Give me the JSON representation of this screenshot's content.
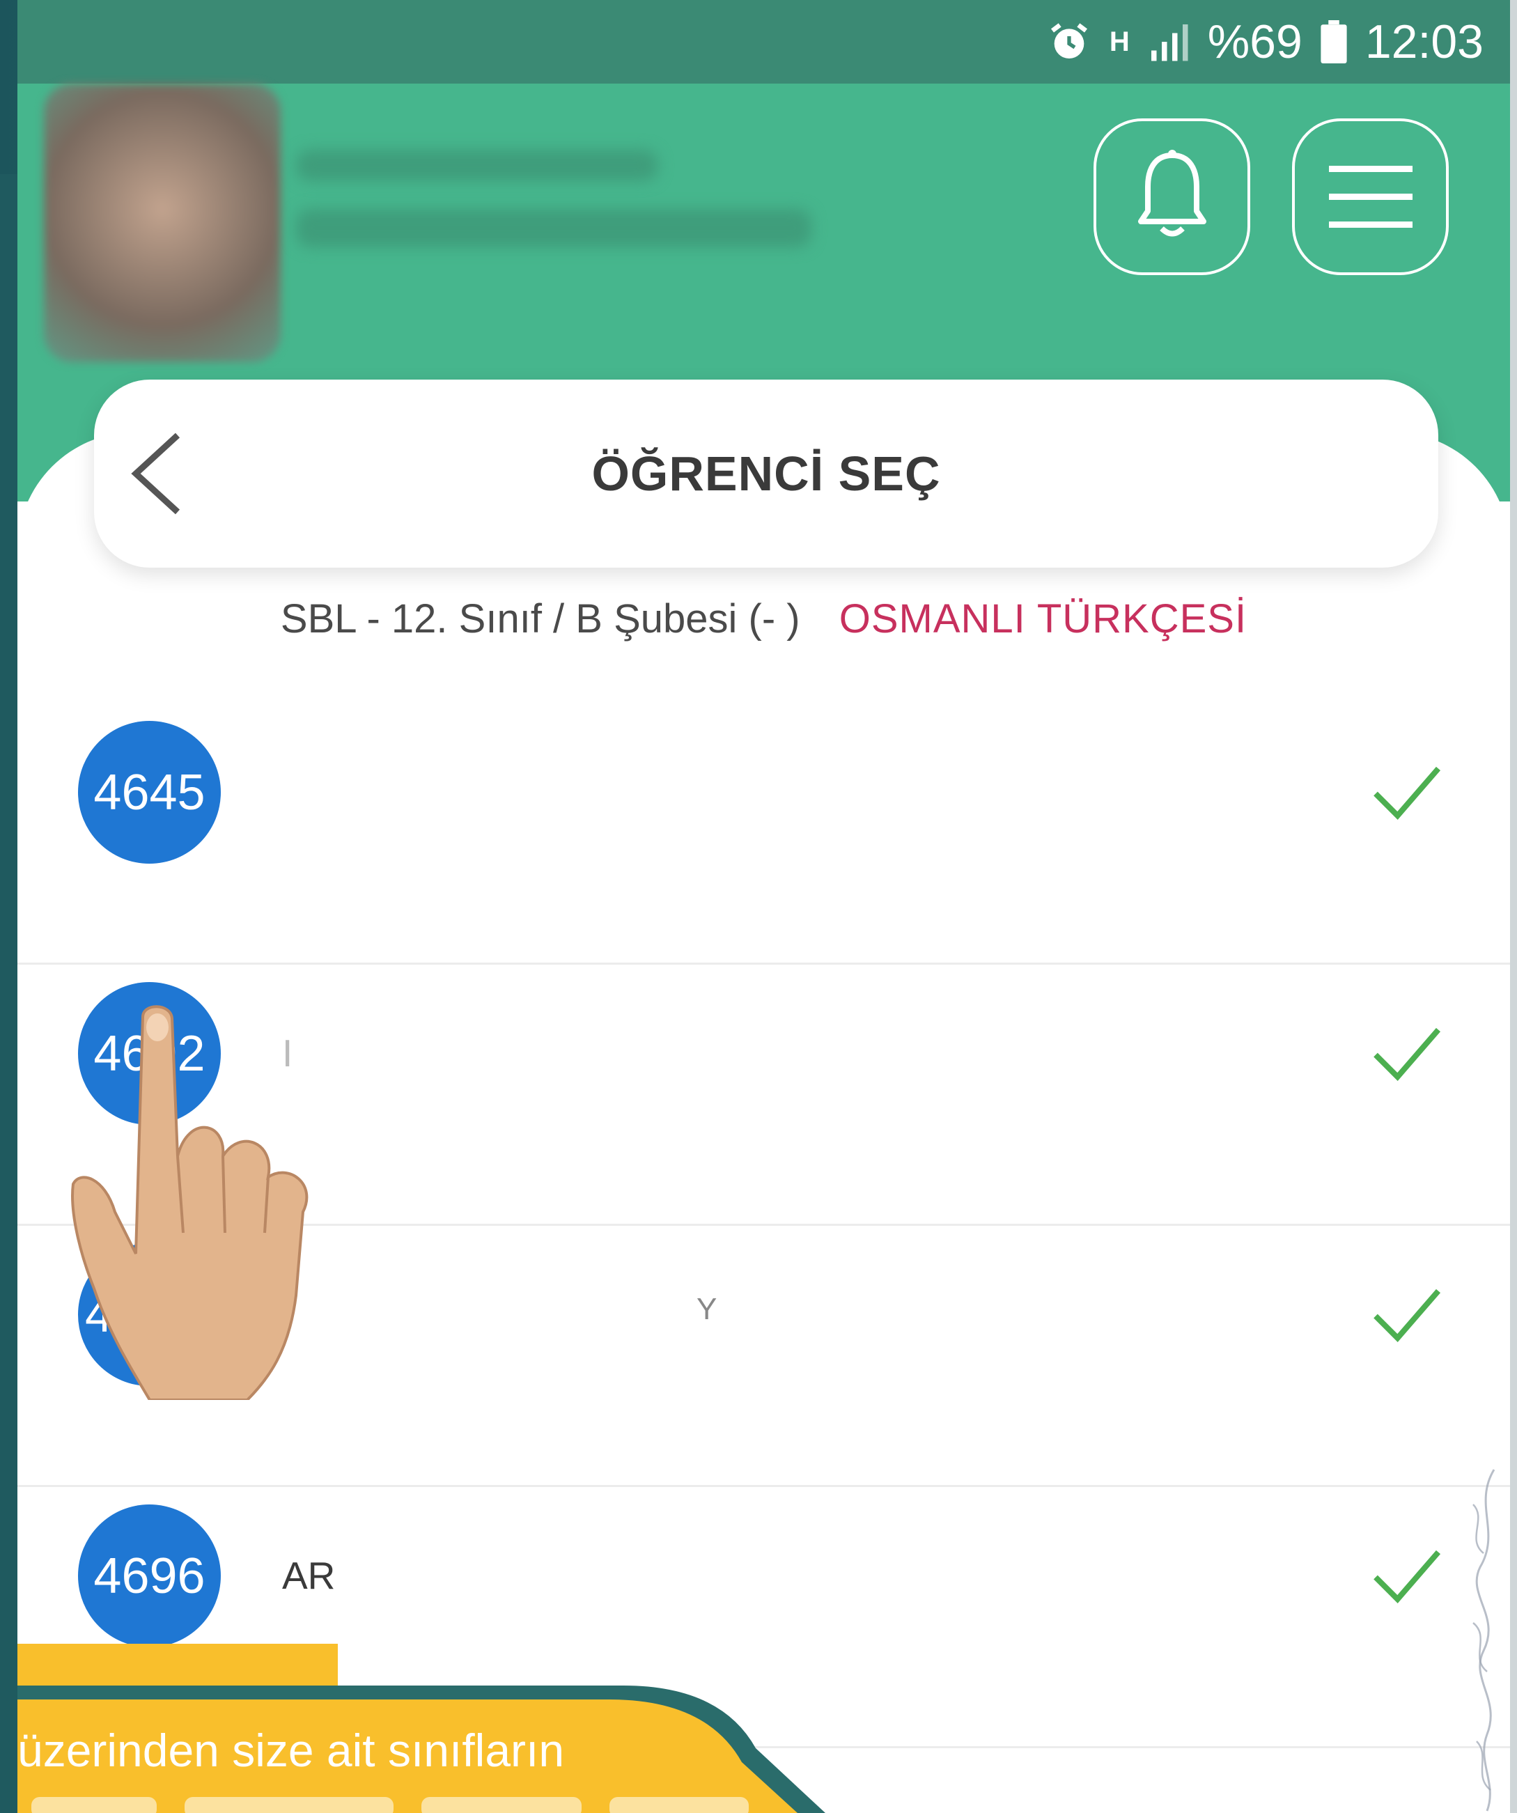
{
  "statusbar": {
    "signal_h": "H",
    "battery": "%69",
    "time": "12:03"
  },
  "header": {
    "icons": [
      "bell-icon",
      "hamburger-menu-icon"
    ]
  },
  "page": {
    "title": "ÖĞRENCİ SEÇ",
    "class_info": "SBL - 12. Sınıf / B Şubesi (- )",
    "course": "OSMANLI TÜRKÇESİ"
  },
  "students": [
    {
      "number": "4645",
      "name": ""
    },
    {
      "number": "4692",
      "name": "I"
    },
    {
      "number": "4",
      "name": "Y"
    },
    {
      "number": "4696",
      "name": "AR"
    }
  ],
  "callout": {
    "text": "üzerinden  size ait sınıfların"
  },
  "colors": {
    "header_green": "#46b68d",
    "number_blue": "#1f77d3",
    "check_green": "#4caf50",
    "course_pink": "#c7305d",
    "callout_yellow": "#f9bf2c"
  }
}
